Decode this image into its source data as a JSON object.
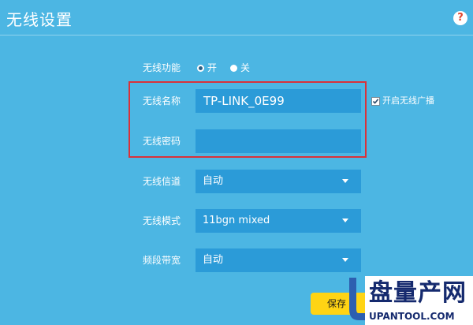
{
  "header": {
    "title": "无线设置",
    "help_symbol": "?"
  },
  "form": {
    "wireless_function": {
      "label": "无线功能",
      "options": [
        "开",
        "关"
      ],
      "selected": "开"
    },
    "ssid": {
      "label": "无线名称",
      "value": "TP-LINK_0E99"
    },
    "broadcast": {
      "label": "开启无线广播",
      "checked": true
    },
    "password": {
      "label": "无线密码",
      "value": ""
    },
    "channel": {
      "label": "无线信道",
      "value": "自动"
    },
    "mode": {
      "label": "无线模式",
      "value": "11bgn mixed"
    },
    "bandwidth": {
      "label": "频段带宽",
      "value": "自动"
    },
    "save_label": "保存"
  },
  "watermark": {
    "name": "盘量产网",
    "domain": "UPANTOOL.COM"
  },
  "colors": {
    "background": "#4cb6e3",
    "field": "#2b9bd8",
    "highlight_border": "#d9323a",
    "save_button": "#ffd414",
    "watermark_text": "#152a6e"
  }
}
